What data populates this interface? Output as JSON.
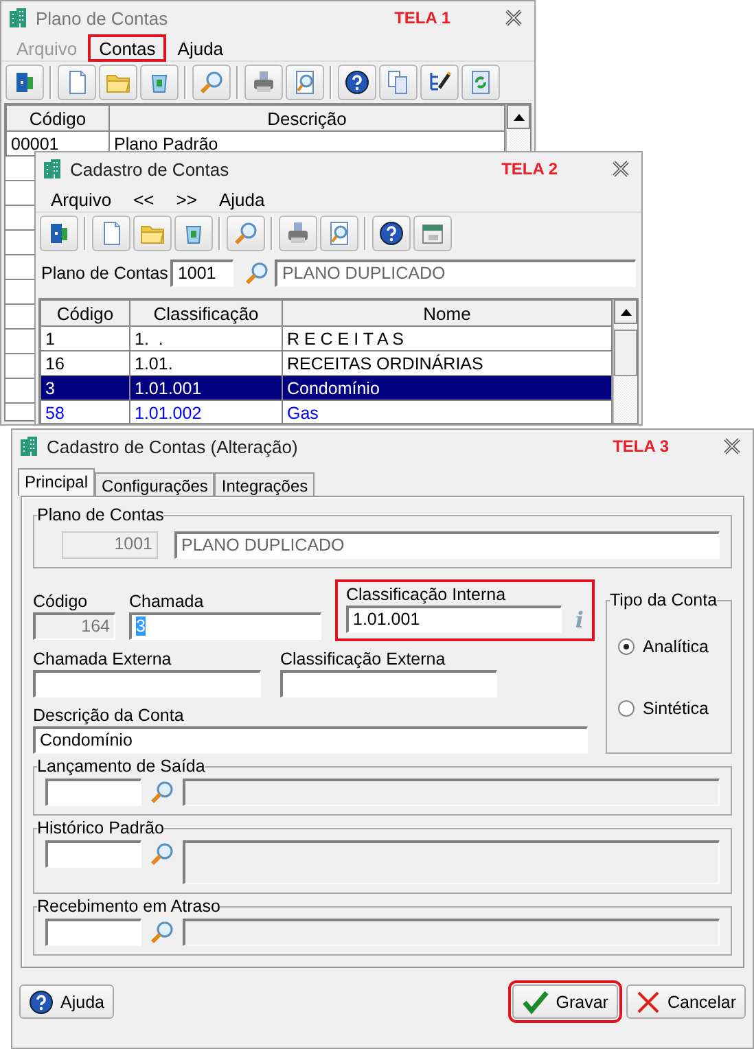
{
  "plano_window": {
    "title": "Plano de Contas",
    "active": false,
    "screen_label": "TELA 1",
    "menu": [
      {
        "label": "Arquivo",
        "disabled": true,
        "highlighted": false
      },
      {
        "label": "Contas",
        "disabled": false,
        "highlighted": true
      },
      {
        "label": "Ajuda",
        "disabled": false,
        "highlighted": false
      }
    ],
    "table": {
      "columns": [
        "Código",
        "Descrição"
      ],
      "rows": [
        {
          "cells": [
            "00001",
            "Plano Padrão"
          ],
          "selected": false
        }
      ]
    }
  },
  "cadastro_window": {
    "title": "Cadastro de Contas",
    "active": true,
    "screen_label": "TELA 2",
    "menu": [
      {
        "label": "Arquivo",
        "disabled": false,
        "highlighted": false
      },
      {
        "label": "<<",
        "disabled": false,
        "highlighted": false
      },
      {
        "label": ">>",
        "disabled": false,
        "highlighted": false
      },
      {
        "label": "Ajuda",
        "disabled": false,
        "highlighted": false
      }
    ],
    "plan_field": {
      "label": "Plano de Contas",
      "code": "1001",
      "name": "PLANO DUPLICADO"
    },
    "table": {
      "columns": [
        "Código",
        "Classificação",
        "Nome"
      ],
      "rows": [
        {
          "cells": [
            "1",
            "1.  .",
            "R E C E I T A S"
          ],
          "selected": false,
          "color": "#000000"
        },
        {
          "cells": [
            "16",
            "1.01.",
            "RECEITAS ORDINÁRIAS"
          ],
          "selected": false,
          "color": "#000000"
        },
        {
          "cells": [
            "3",
            "1.01.001",
            "Condomínio"
          ],
          "selected": true
        },
        {
          "cells": [
            "58",
            "1.01.002",
            "Gas"
          ],
          "selected": false,
          "color": "#0000ff"
        }
      ]
    }
  },
  "alteracao_window": {
    "title": "Cadastro de Contas (Alteração)",
    "active": true,
    "screen_label": "TELA 3",
    "tabs": [
      {
        "label": "Principal",
        "selected": true
      },
      {
        "label": "Configurações",
        "selected": false
      },
      {
        "label": "Integrações",
        "selected": false
      }
    ],
    "plan_group": {
      "legend": "Plano de Contas",
      "code": "1001",
      "name": "PLANO DUPLICADO"
    },
    "codigo": {
      "label": "Código",
      "value": "164",
      "disabled": true
    },
    "chamada": {
      "label": "Chamada",
      "value": "3",
      "text_selected": true
    },
    "classificacao_interna": {
      "label": "Classificação Interna",
      "value": "1.01.001",
      "highlighted": true,
      "info_glyph": "i"
    },
    "tipo_conta": {
      "legend": "Tipo da Conta",
      "options": [
        {
          "label": "Analítica",
          "selected": true
        },
        {
          "label": "Sintética",
          "selected": false
        }
      ]
    },
    "chamada_externa": {
      "label": "Chamada Externa"
    },
    "classificacao_externa": {
      "label": "Classificação Externa"
    },
    "descricao": {
      "label": "Descrição da Conta",
      "value": "Condomínio"
    },
    "lookups": [
      {
        "legend": "Lançamento de Saída",
        "kind": "line"
      },
      {
        "legend": "Histórico Padrão",
        "kind": "memo"
      },
      {
        "legend": "Recebimento em Atraso",
        "kind": "line"
      }
    ],
    "buttons": [
      {
        "label": "Ajuda",
        "kind": "help",
        "highlighted": false
      },
      {
        "label": "Gravar",
        "kind": "save",
        "highlighted": true
      },
      {
        "label": "Cancelar",
        "kind": "cancel",
        "highlighted": false
      }
    ]
  }
}
